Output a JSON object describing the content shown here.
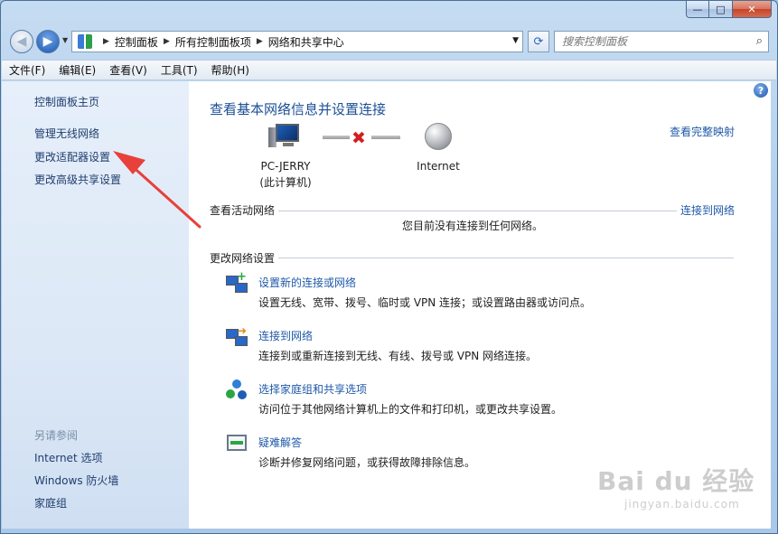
{
  "window": {
    "caption": {
      "min": "—",
      "max": "□",
      "close": "✕"
    }
  },
  "address_bar": {
    "crumbs": [
      "控制面板",
      "所有控制面板项",
      "网络和共享中心"
    ],
    "search_placeholder": "搜索控制面板"
  },
  "menu": {
    "items": [
      "文件(F)",
      "编辑(E)",
      "查看(V)",
      "工具(T)",
      "帮助(H)"
    ]
  },
  "sidebar": {
    "home": "控制面板主页",
    "links": [
      "管理无线网络",
      "更改适配器设置",
      "更改高级共享设置"
    ],
    "see_also_heading": "另请参阅",
    "see_also": [
      "Internet 选项",
      "Windows 防火墙",
      "家庭组"
    ]
  },
  "main": {
    "title": "查看基本网络信息并设置连接",
    "full_map_link": "查看完整映射",
    "pc_label_line1": "PC-JERRY",
    "pc_label_line2": "(此计算机)",
    "internet_label": "Internet",
    "active_networks_label": "查看活动网络",
    "connect_link": "连接到网络",
    "no_connection_text": "您目前没有连接到任何网络。",
    "change_settings_label": "更改网络设置",
    "tasks": [
      {
        "title": "设置新的连接或网络",
        "desc": "设置无线、宽带、拨号、临时或 VPN 连接；或设置路由器或访问点。"
      },
      {
        "title": "连接到网络",
        "desc": "连接到或重新连接到无线、有线、拨号或 VPN 网络连接。"
      },
      {
        "title": "选择家庭组和共享选项",
        "desc": "访问位于其他网络计算机上的文件和打印机，或更改共享设置。"
      },
      {
        "title": "疑难解答",
        "desc": "诊断并修复网络问题，或获得故障排除信息。"
      }
    ]
  },
  "icons": {
    "back": "back-arrow-icon",
    "forward": "forward-arrow-icon",
    "refresh": "refresh-icon",
    "search": "search-icon",
    "help": "help-icon"
  },
  "watermark": {
    "main": "Bai du 经验",
    "sub": "jingyan.baidu.com"
  },
  "colors": {
    "link": "#1f59a8",
    "title": "#1b4f96",
    "sidebar_bg": "#dce8f6",
    "annotation_arrow": "#e8403a"
  }
}
